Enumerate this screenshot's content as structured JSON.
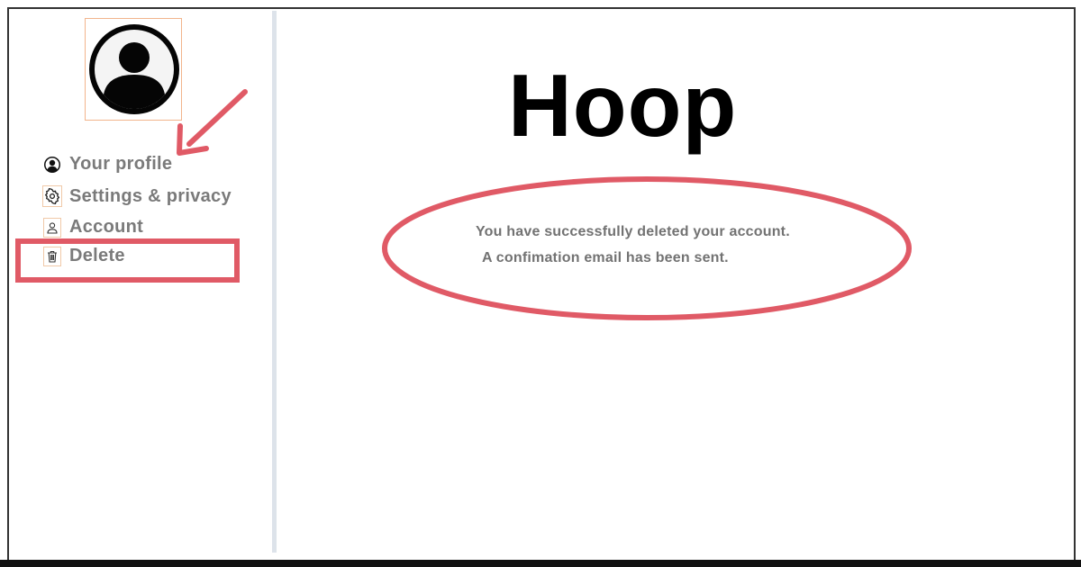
{
  "app": {
    "brand": "Hoop"
  },
  "sidebar": {
    "items": [
      {
        "label": "Your profile",
        "icon": "user-circle-icon"
      },
      {
        "label": "Settings & privacy",
        "icon": "gear-icon"
      },
      {
        "label": "Account",
        "icon": "person-outline-icon"
      },
      {
        "label": "Delete",
        "icon": "trash-icon"
      }
    ]
  },
  "main": {
    "message_line1": "You have successfully deleted your account.",
    "message_line2": "A confimation email has been sent."
  },
  "colors": {
    "annotation": "#e05a66",
    "sidebar_text": "#7a7a7a",
    "message_text": "#727272",
    "divider": "#dde3ea"
  }
}
